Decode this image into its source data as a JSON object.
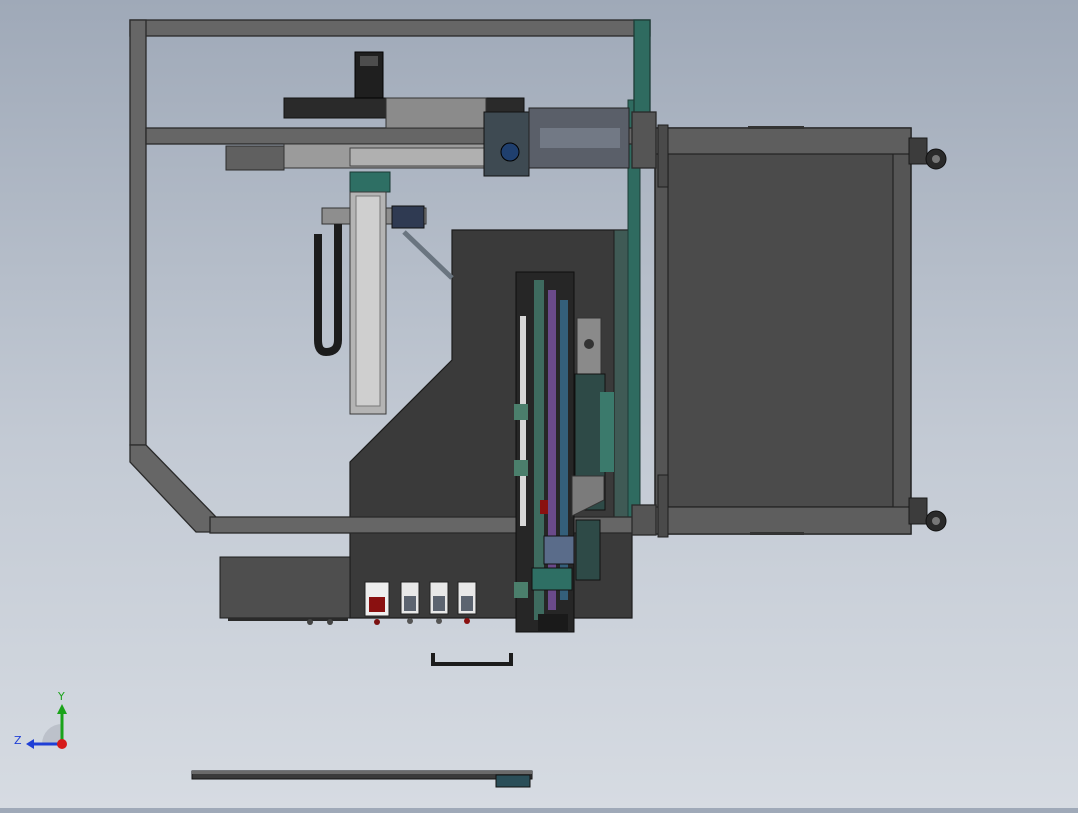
{
  "viewport": {
    "background_top": "#9fa9b8",
    "background_bottom": "#d6dbe2",
    "frame_color": "#5f5f5f",
    "frame_edge": "#2b2b2b",
    "panel_color": "#3a3a3a",
    "cabinet_color": "#505050",
    "accent_green": "#2e6f64",
    "accent_purple": "#6a4a8a",
    "accent_red": "#8a1010"
  },
  "triad": {
    "y_label": "Y",
    "z_label": "Z",
    "y_color": "#1aa31a",
    "z_color": "#1f3fd6",
    "x_color": "#d61a1a"
  },
  "control_panel": {
    "buttons": [
      "emergency-stop",
      "switch-1",
      "switch-2",
      "switch-3"
    ]
  },
  "icons": [
    "axis-triad-icon"
  ]
}
